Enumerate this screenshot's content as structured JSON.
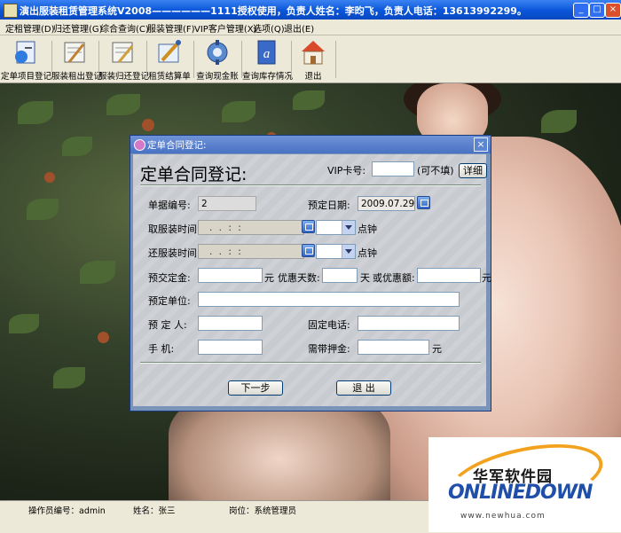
{
  "window": {
    "title": "演出服装租赁管理系统V2008——————1111授权使用，负责人姓名：李昀飞，负责人电话：13613992299。",
    "minimize": "_",
    "maximize": "□",
    "close": "×"
  },
  "menu": [
    "定租管理(D)",
    "归还管理(G)",
    "综合查询(C)",
    "服装管理(F)",
    "VIP客户管理(X)",
    "选项(Q)",
    "退出(E)"
  ],
  "toolbar": [
    {
      "label": "定单项目登记",
      "icon": "register-form-icon"
    },
    {
      "label": "服装租出登记",
      "icon": "rent-out-notepad-icon"
    },
    {
      "label": "服装归还登记",
      "icon": "return-notepad-icon"
    },
    {
      "label": "租赁结算单",
      "icon": "settlement-tools-icon"
    },
    {
      "label": "查询现金账",
      "icon": "cash-gear-icon"
    },
    {
      "label": "查询库存情况",
      "icon": "inventory-book-icon"
    },
    {
      "label": "退出",
      "icon": "house-exit-icon"
    }
  ],
  "dialog": {
    "title": "定单合同登记:",
    "close": "×",
    "heading": "定单合同登记:",
    "vip_label": "VIP卡号:",
    "vip_value": "",
    "vip_hint": "(可不填)",
    "detail_button": "详细",
    "order_no_label": "单据编号:",
    "order_no_value": "2",
    "book_date_label": "预定日期:",
    "book_date_value": "2009.07.29",
    "pickup_label": "取服装时间:",
    "pickup_value": ". .  : :",
    "pickup_unit": "点钟",
    "return_label": "还服装时间:",
    "return_value": ". .  : :",
    "return_unit": "点钟",
    "deposit_label": "预交定金:",
    "deposit_value": "",
    "deposit_unit": "元",
    "discount_days_label": "优惠天数:",
    "discount_days_value": "",
    "discount_days_unit": "天",
    "discount_amount_label": "或优惠额:",
    "discount_amount_value": "",
    "discount_amount_unit": "元",
    "unit_label": "预定单位:",
    "unit_value": "",
    "person_label": "预 定 人:",
    "person_value": "",
    "phone_label": "固定电话:",
    "phone_value": "",
    "mobile_label": "手    机:",
    "mobile_value": "",
    "guarantee_label": "需带押金:",
    "guarantee_value": "",
    "guarantee_unit": "元",
    "next_button": "下一步",
    "exit_button": "退  出"
  },
  "status": {
    "operator": "操作员编号：admin",
    "name": "姓名：张三",
    "position": "岗位：系统管理员"
  },
  "watermark": {
    "brand_cn": "华军软件园",
    "brand_en": "ONLINEDOWN",
    "url": "www.newhua.com"
  },
  "colors": {
    "titlebar": "#0a55d8",
    "dialog_frame": "#7a93b8",
    "dialog_body": "#c8cbd0",
    "watermark_orange": "#f2a21e",
    "watermark_blue": "#1f4fa8"
  }
}
